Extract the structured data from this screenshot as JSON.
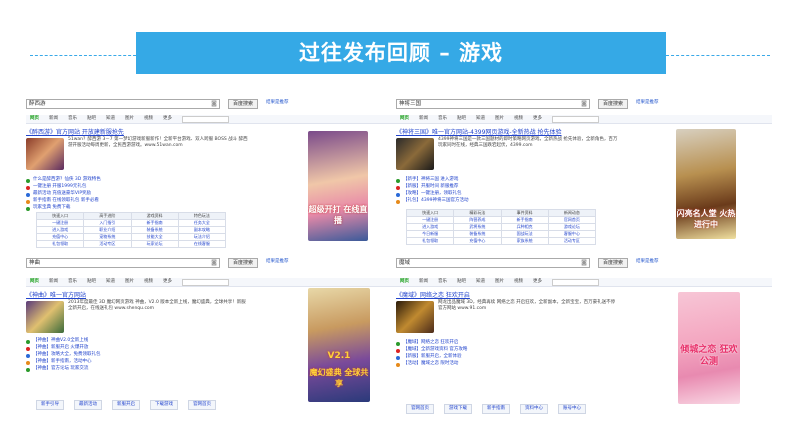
{
  "slide_title": "过往发布回顾 – 游戏",
  "panels": [
    {
      "query": "醉西游",
      "search_button": "百度搜索",
      "adv_link": "结果是推荐",
      "tabs": [
        "网页",
        "新闻",
        "音乐",
        "贴吧",
        "知道",
        "图片",
        "视频"
      ],
      "tab_more": "更多",
      "title": "《醉西游》官方网站 开放建新服抢先",
      "desc": "51wan？醉西游 3－7 第一梦幻游戏新服新作！全新平台游戏、双人跨服 BOSS 战斗 醉西游开服活动每周更新，全民西游游戏。www.51wan.com",
      "links": [
        "什么是醉西游？仙侠 3D 游戏特色",
        "一键注册 开服1999元礼包",
        "最新活动 充值送豪华VIP奖励",
        "新手指南 在线领取礼包 新手必看",
        "玩家宝典 免费下载"
      ],
      "grid": [
        [
          "快速入口",
          "高手进阶",
          "游戏资料",
          "特色玩法"
        ],
        [
          "一键注册",
          "入门指引",
          "新手指南",
          "任务大全"
        ],
        [
          "进入游戏",
          "职业介绍",
          "装备系统",
          "副本攻略"
        ],
        [
          "充值中心",
          "宠物系统",
          "技能大全",
          "玩法介绍"
        ],
        [
          "礼包领取",
          "活动专区",
          "玩家论坛",
          "在线客服"
        ]
      ],
      "ad_caption": "超级开打 在线直播"
    },
    {
      "query": "神将三国",
      "search_button": "百度搜索",
      "adv_link": "结果是推荐",
      "tabs": [
        "网页",
        "新闻",
        "音乐",
        "贴吧",
        "知道",
        "图片",
        "视频"
      ],
      "tab_more": "更多",
      "title": "《神将三国》唯一官方网站-4399网页游戏-全新热战 抢先体验",
      "desc": "4399神将三国是一款三国题材的即时策略网页游戏，全新热战 抢先体验，全新角色，百万玩家同时在线，经典三国跌宕起伏，4399.com",
      "links": [
        "【新手】神将三国 进入游戏",
        "【新服】开服时间 新服推荐",
        "【攻略】一键注册，领取礼包",
        "【礼包】4399神将三国官方活动"
      ],
      "grid": [
        [
          "快速入口",
          "精彩玩法",
          "事件资料",
          "新闻动态"
        ],
        [
          "一键注册",
          "阵营养成",
          "新手指南",
          "官网首页"
        ],
        [
          "进入游戏",
          "武将系统",
          "兵种相克",
          "游戏论坛"
        ],
        [
          "今日新服",
          "装备系统",
          "国战玩法",
          "客服中心"
        ],
        [
          "礼包领取",
          "充值中心",
          "家族系统",
          "活动专区"
        ]
      ],
      "ad_caption": "闪亮名人堂 火热进行中"
    },
    {
      "query": "神曲",
      "search_button": "百度搜索",
      "adv_link": "结果是推荐",
      "tabs": [
        "网页",
        "新闻",
        "音乐",
        "贴吧",
        "知道",
        "图片",
        "视频"
      ],
      "tab_more": "更多",
      "title": "《神曲》唯一官方网站",
      "desc": "2013年度最佳 3D 魔幻网页游戏 神曲，V2.0 版本全新上线，魔幻盛典，全球共享！新服全新开启，在线送礼包 www.shenqu.com",
      "links": [
        "【神曲】神曲V2.0全新上线",
        "【神曲】新服开启 火爆开放",
        "【神曲】攻略大全，免费领取礼包",
        "【神曲】新手指南，活动中心",
        "【神曲】官方论坛 玩家交流"
      ],
      "buttons": [
        "新手引导",
        "最新活动",
        "新服开启",
        "下载游戏",
        "官网首页"
      ],
      "ad_caption_1": "V2.1",
      "ad_caption_2": "魔幻盛典 全球共享"
    },
    {
      "query": "魔域",
      "search_button": "百度搜索",
      "adv_link": "结果是推荐",
      "tabs": [
        "网页",
        "新闻",
        "音乐",
        "贴吧",
        "知道",
        "图片",
        "视频"
      ],
      "tab_more": "更多",
      "title": "《魔域》网络之恋 狂欢开启",
      "desc": "网龙出品魔域 3D，经典再续 网络之恋 开启狂欢，全新副本，全新宝宝，百万豪礼送不停 官方网站 www.91.com",
      "links": [
        "【魔域】网络之恋 狂欢开启",
        "【魔域】全新游戏资料 官方攻略",
        "【新服】新服开启，全新体验",
        "【活动】魔域之恋 限时活动"
      ],
      "buttons": [
        "官网首页",
        "游戏下载",
        "新手指南",
        "资料中心",
        "账号中心"
      ],
      "ad_caption": "倾城之恋 狂欢公测"
    }
  ]
}
